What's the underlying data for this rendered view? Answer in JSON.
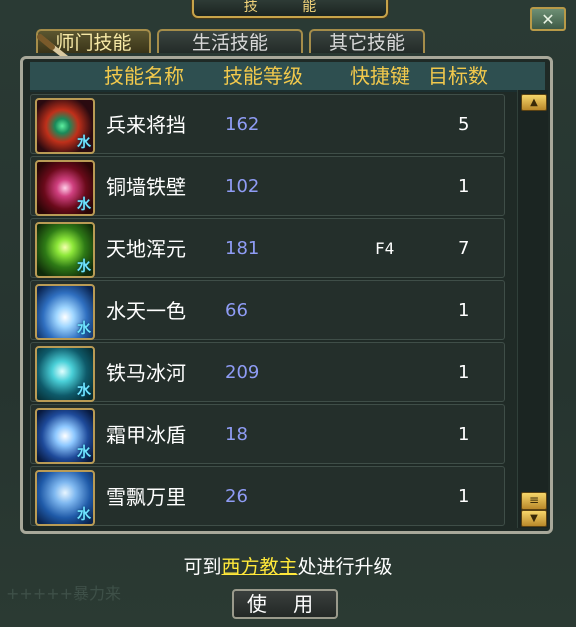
{
  "window": {
    "title": "技 能"
  },
  "tabs": [
    {
      "label": "师门技能",
      "active": true
    },
    {
      "label": "生活技能",
      "active": false
    },
    {
      "label": "其它技能",
      "active": false
    }
  ],
  "table": {
    "headers": {
      "name": "技能名称",
      "level": "技能等级",
      "hotkey": "快捷键",
      "targets": "目标数"
    },
    "rows": [
      {
        "name": "兵来将挡",
        "level": "162",
        "hotkey": "",
        "targets": "5",
        "element": "水",
        "icon": "swords-aura-icon"
      },
      {
        "name": "铜墙铁壁",
        "level": "102",
        "hotkey": "",
        "targets": "1",
        "element": "水",
        "icon": "shield-burst-icon"
      },
      {
        "name": "天地浑元",
        "level": "181",
        "hotkey": "F4",
        "targets": "7",
        "element": "水",
        "icon": "green-orb-icon"
      },
      {
        "name": "水天一色",
        "level": "66",
        "hotkey": "",
        "targets": "1",
        "element": "水",
        "icon": "water-splash-icon"
      },
      {
        "name": "铁马冰河",
        "level": "209",
        "hotkey": "",
        "targets": "1",
        "element": "水",
        "icon": "ice-horse-icon"
      },
      {
        "name": "霜甲冰盾",
        "level": "18",
        "hotkey": "",
        "targets": "1",
        "element": "水",
        "icon": "frost-armor-icon"
      },
      {
        "name": "雪飘万里",
        "level": "26",
        "hotkey": "",
        "targets": "1",
        "element": "水",
        "icon": "snowfall-icon"
      }
    ]
  },
  "footer": {
    "hint_before": "可到",
    "npc_link": "西方教主",
    "hint_after": "处进行升级",
    "use_button": "使 用",
    "ghost_text": "+++++暴力来"
  },
  "colors": {
    "header_text": "#f2c94c",
    "level_text": "#8f9cf5",
    "npc_link": "#ffe83a"
  }
}
